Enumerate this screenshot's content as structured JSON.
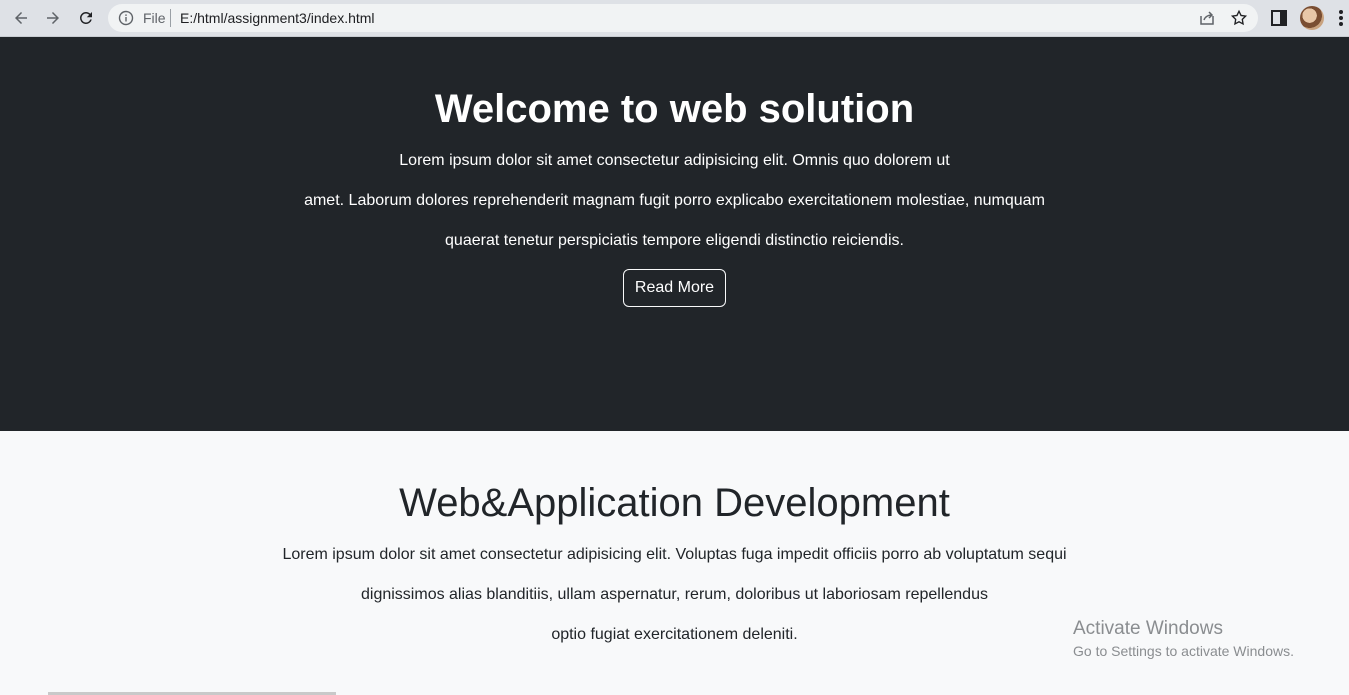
{
  "browser": {
    "file_label": "File",
    "url": "E:/html/assignment3/index.html",
    "icons": [
      "back-arrow-icon",
      "forward-arrow-icon",
      "reload-icon",
      "info-icon",
      "share-icon",
      "star-icon",
      "side-panel-icon",
      "profile-avatar",
      "kebab-menu-icon"
    ]
  },
  "hero": {
    "title": "Welcome to web solution",
    "lines": [
      "Lorem ipsum dolor sit amet consectetur adipisicing elit. Omnis quo dolorem ut",
      "amet. Laborum dolores reprehenderit magnam fugit porro explicabo exercitationem molestiae, numquam",
      "quaerat tenetur perspiciatis tempore eligendi distinctio reiciendis."
    ],
    "button_label": "Read More",
    "background": "#212529"
  },
  "section2": {
    "title": "Web&Application Development",
    "lines": [
      "Lorem ipsum dolor sit amet consectetur adipisicing elit. Voluptas fuga impedit officiis porro ab voluptatum sequi",
      "dignissimos alias blanditiis, ullam aspernatur, rerum, doloribus ut laboriosam repellendus",
      "optio fugiat exercitationem deleniti."
    ],
    "background": "#f8f9fa"
  },
  "watermark": {
    "title": "Activate Windows",
    "subtitle": "Go to Settings to activate Windows."
  }
}
